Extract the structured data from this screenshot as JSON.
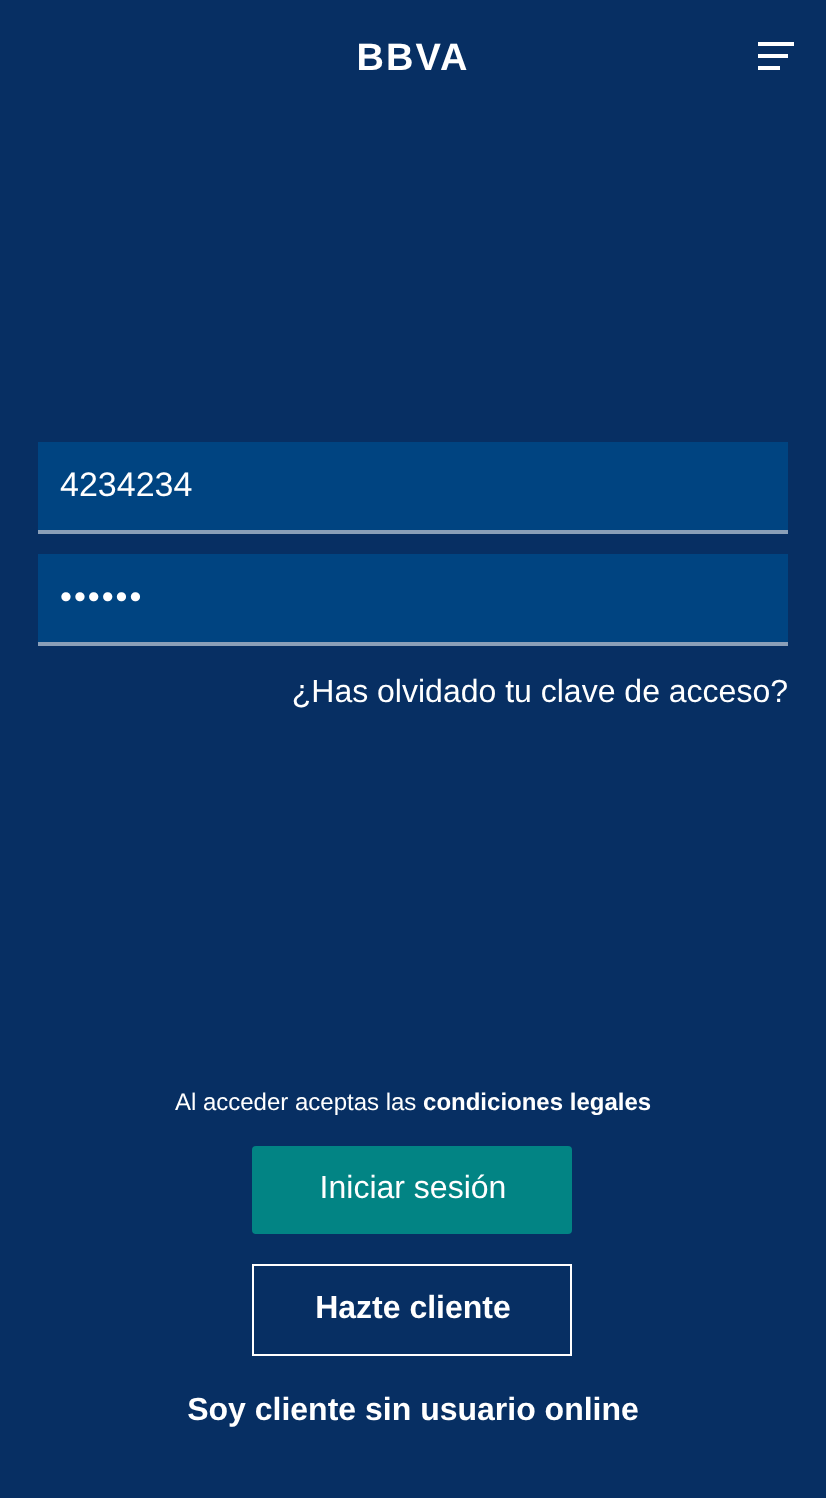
{
  "header": {
    "logo": "BBVA"
  },
  "login": {
    "user_field": {
      "value": "4234234"
    },
    "password_field": {
      "value": "••••••"
    },
    "forgot_link": "¿Has olvidado tu clave de acceso?"
  },
  "legal_notice": "Al acceder aceptas las **condiciones legales**",
  "buttons": [
    {
      "label": "Iniciar sesión",
      "kind": "primary"
    },
    {
      "label": "Hazte cliente",
      "kind": "outline"
    },
    {
      "label": "Soy cliente sin usuario online",
      "kind": "link"
    }
  ]
}
